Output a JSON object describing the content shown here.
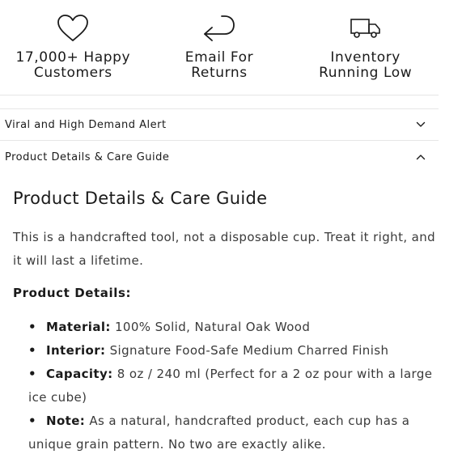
{
  "features": [
    {
      "icon": "heart-icon",
      "label_line1": "17,000+ Happy",
      "label_line2": "Customers"
    },
    {
      "icon": "return-arrow-icon",
      "label_line1": "Email For",
      "label_line2": "Returns"
    },
    {
      "icon": "truck-icon",
      "label_line1": "Inventory",
      "label_line2": "Running Low"
    }
  ],
  "accordion": [
    {
      "label": "Viral and High Demand Alert",
      "state": "collapsed",
      "icon": "chevron-down-icon"
    },
    {
      "label": "Product Details & Care Guide",
      "state": "expanded",
      "icon": "chevron-up-icon"
    }
  ],
  "panel": {
    "title": "Product Details & Care Guide",
    "intro": "This is a handcrafted tool, not a disposable cup. Treat it right, and it will last a lifetime.",
    "subhead": "Product Details:",
    "items": [
      {
        "term": "Material:",
        "text": "100% Solid, Natural Oak Wood"
      },
      {
        "term": "Interior:",
        "text": "Signature Food-Safe Medium Charred Finish"
      },
      {
        "term": "Capacity:",
        "text": "8 oz / 240 ml (Perfect for a 2 oz pour with a large ice cube)"
      },
      {
        "term": "Note:",
        "text": "As a natural, handcrafted product, each cup has a unique grain pattern. No two are exactly alike."
      }
    ]
  },
  "colors": {
    "text": "#1a1a1a",
    "body_text": "#3a3a3a",
    "divider": "#e6e6e6",
    "background": "#ffffff"
  }
}
